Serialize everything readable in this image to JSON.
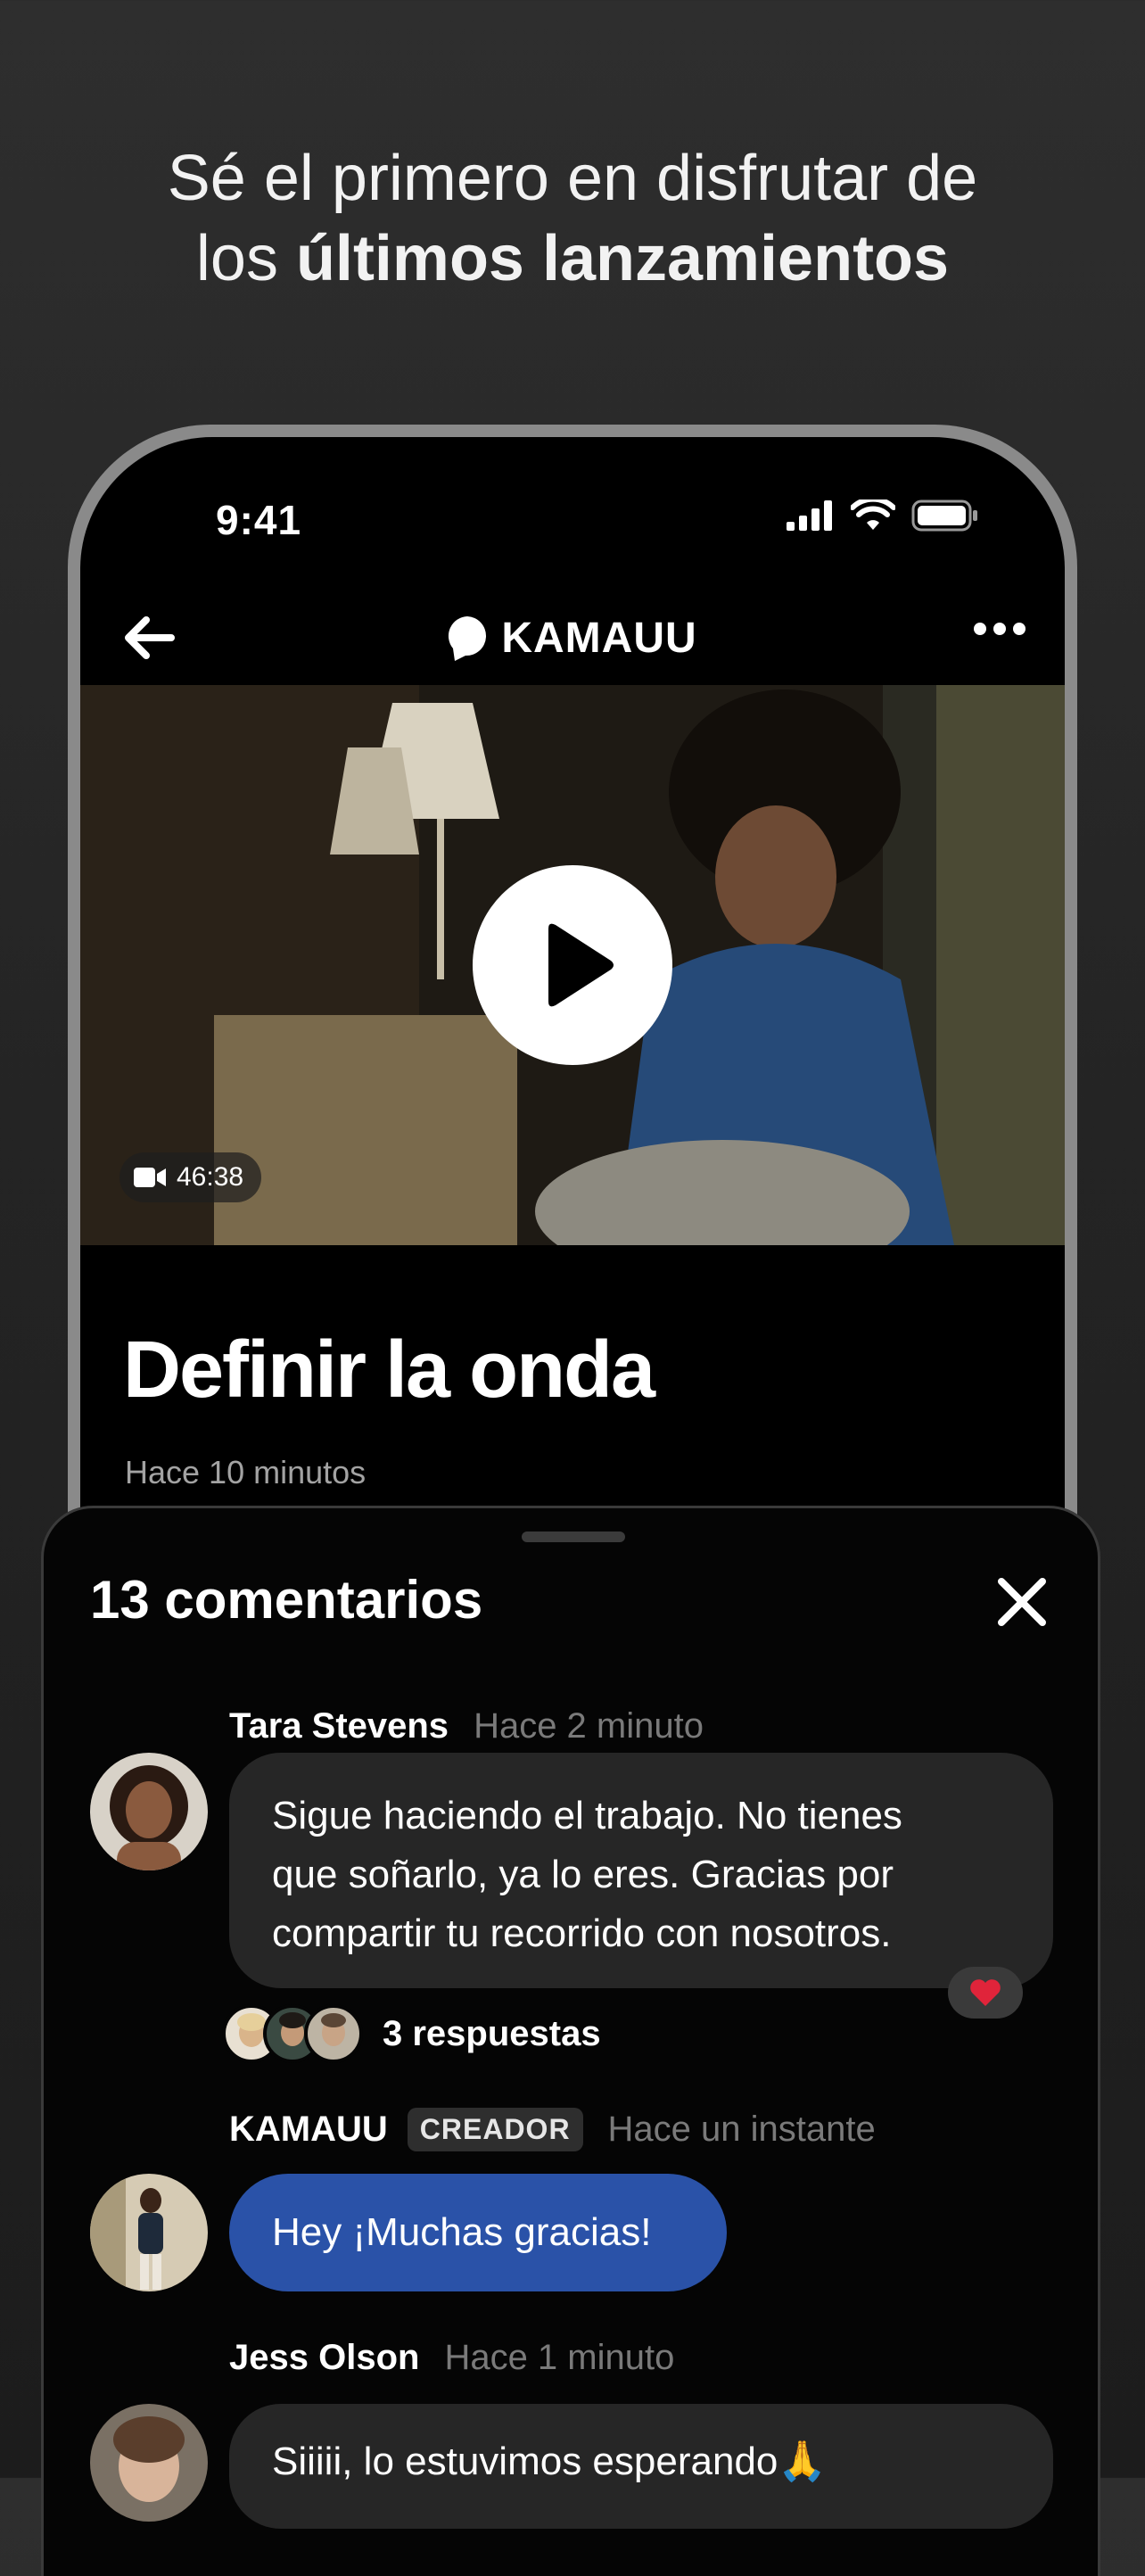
{
  "headline": {
    "line1": "Sé el primero en disfrutar de",
    "line2_pre": "los ",
    "line2_bold": "últimos lanzamientos"
  },
  "status_bar": {
    "time": "9:41",
    "icons": [
      "signal-icon",
      "wifi-icon",
      "battery-icon"
    ]
  },
  "nav": {
    "brand": "KAMAUU",
    "back_icon": "arrow-left-icon",
    "more_icon": "ellipsis-icon"
  },
  "video": {
    "duration": "46:38",
    "duration_icon": "video-camera-icon",
    "play_icon": "play-icon"
  },
  "post": {
    "title": "Definir la onda",
    "time": "Hace 10 minutos"
  },
  "comments": {
    "title": "13 comentarios",
    "close_icon": "close-icon",
    "items": [
      {
        "name": "Tara Stevens",
        "ago": "Hace 2 minuto",
        "text_lines": [
          "Sigue haciendo el trabajo. No tienes",
          "que soñarlo, ya lo eres. Gracias por",
          "compartir tu recorrido con nosotros."
        ],
        "reaction": "❤️",
        "replies": "3 respuestas"
      },
      {
        "name": "KAMAUU",
        "badge": "CREADOR",
        "ago": "Hace un instante",
        "text": "Hey ¡Muchas gracias!"
      },
      {
        "name": "Jess Olson",
        "ago": "Hace 1 minuto",
        "text": "Siiiii, lo estuvimos esperando🙏"
      }
    ]
  },
  "colors": {
    "accent_blue": "#2a52a8",
    "bubble_gray": "#262626",
    "background": "#2a2a2a"
  }
}
